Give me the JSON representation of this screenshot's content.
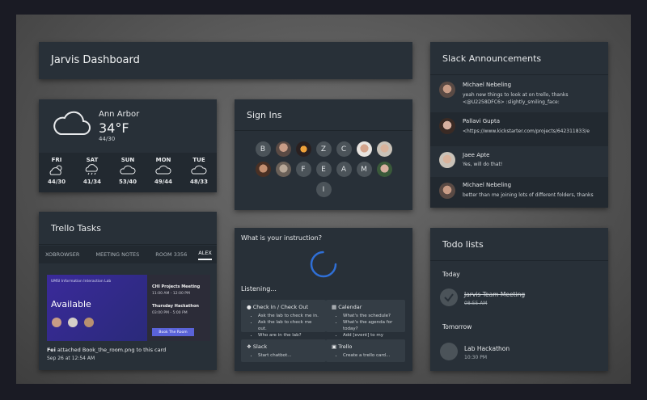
{
  "dashboard": {
    "title": "Jarvis Dashboard"
  },
  "weather": {
    "city": "Ann Arbor",
    "temp": "34°F",
    "range": "44/30",
    "days": [
      {
        "day": "FRI",
        "icon": "partly-sunny-icon",
        "temps": "44/30"
      },
      {
        "day": "SAT",
        "icon": "rain-icon",
        "temps": "41/34"
      },
      {
        "day": "SUN",
        "icon": "cloud-icon",
        "temps": "53/40"
      },
      {
        "day": "MON",
        "icon": "cloud-icon",
        "temps": "49/44"
      },
      {
        "day": "TUE",
        "icon": "cloud-icon",
        "temps": "48/33"
      }
    ]
  },
  "signins": {
    "title": "Sign Ins",
    "row1": [
      "B",
      "photo",
      "photo",
      "Z",
      "C",
      "photo",
      "photo"
    ],
    "row2": [
      "photo",
      "photo",
      "F",
      "E",
      "A",
      "M",
      "photo"
    ],
    "row3": [
      "I"
    ]
  },
  "slack": {
    "title": "Slack Announcements",
    "messages": [
      {
        "name": "Michael Nebeling",
        "text": "yeah new things to look at on trello, thanks <@U2258DFC6> :slightly_smiling_face:"
      },
      {
        "name": "Pallavi Gupta",
        "text": "<https://www.kickstarter.com/projects/642311833/e"
      },
      {
        "name": "Jaee Apte",
        "text": "Yes, will do that!"
      },
      {
        "name": "Michael Nebeling",
        "text": "better than me joining lots of different folders, thanks"
      }
    ]
  },
  "trello": {
    "title": "Trello Tasks",
    "tabs": [
      "XOBROWSER",
      "MEETING NOTES",
      "ROOM 3356",
      "ALEX"
    ],
    "room_label": "UMSI Information Interaction Lab",
    "room_status": "Available",
    "events": [
      {
        "title": "CHI Projects Meeting",
        "time": "11:00 AM - 12:00 PM"
      },
      {
        "title": "Thursday Hackathon",
        "time": "03:00 PM - 5:00 PM"
      }
    ],
    "book_button": "Book The Room",
    "activity_user": "Fei",
    "activity_text": "attached Book_the_room.png to this card",
    "activity_time": "Sep 26 at 12:54 AM"
  },
  "instruction": {
    "prompt": "What is your instruction?",
    "status": "Listening...",
    "commands": [
      {
        "icon": "person-icon",
        "title": "Check In / Check Out",
        "items": [
          "Ask the lab to check me in.",
          "Ask the lab to check me out.",
          "Who are in the lab?"
        ]
      },
      {
        "icon": "calendar-icon",
        "title": "Calendar",
        "items": [
          "What's the schedule?",
          "What's the agenda for today?",
          "Add [event] to my schedule."
        ]
      },
      {
        "icon": "slack-icon",
        "title": "Slack",
        "items": [
          "Start chatbot..."
        ]
      },
      {
        "icon": "trello-icon",
        "title": "Trello",
        "items": [
          "Create a trello card..."
        ]
      }
    ]
  },
  "todo": {
    "title": "Todo lists",
    "sections": [
      {
        "heading": "Today",
        "task": "Jarvis Team Meeting",
        "time": "08:55 AM",
        "done": true
      },
      {
        "heading": "Tomorrow",
        "task": "Lab Hackathon",
        "time": "10:30 PM",
        "done": false
      }
    ]
  },
  "colors": {
    "card": "#283038",
    "accent": "#2f6fd6",
    "book": "#5a63d8"
  }
}
